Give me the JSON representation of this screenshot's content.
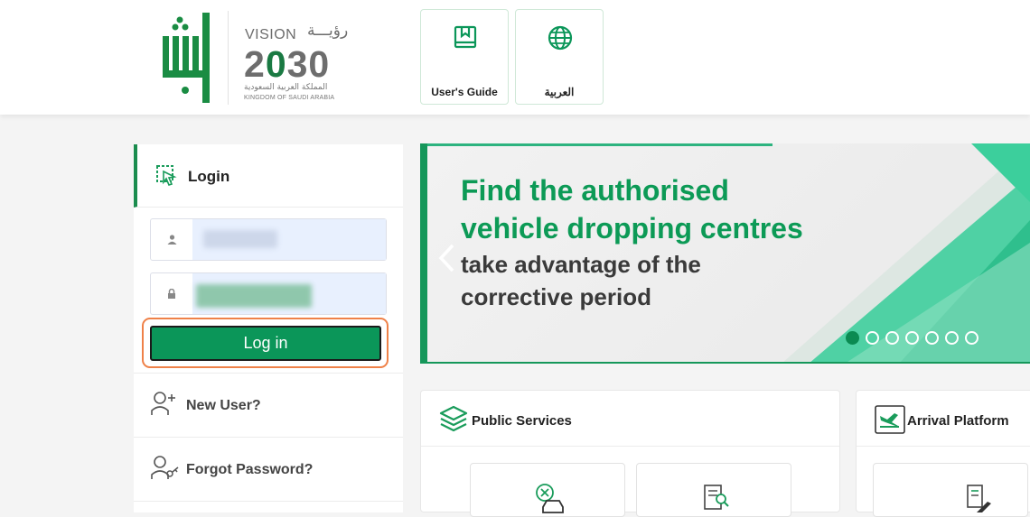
{
  "header": {
    "vision_word": "VISION",
    "vision_arabic": "رؤيـــة",
    "vision_year_prefix": "2",
    "vision_year_mid": "0",
    "vision_year_suffix": "30",
    "kingdom_arabic": "المملكة العربية السعودية",
    "kingdom_english": "KINGDOM OF SAUDI ARABIA",
    "buttons": [
      {
        "label": "User's Guide",
        "icon": "book-icon"
      },
      {
        "label": "العربية",
        "icon": "globe-icon"
      }
    ]
  },
  "login": {
    "title": "Login",
    "username_value": "",
    "password_value": "",
    "login_button": "Log in",
    "new_user": "New User?",
    "forgot_password": "Forgot Password?"
  },
  "banner": {
    "line1": "Find the authorised",
    "line2": "vehicle dropping centres",
    "line3": "take advantage of the",
    "line4": "corrective period",
    "slide_count": 7,
    "active_slide": 1
  },
  "cards": [
    {
      "title": "Public Services",
      "icon": "layers-icon"
    },
    {
      "title": "Arrival Platform",
      "icon": "airplane-arrival-icon"
    }
  ],
  "colors": {
    "brand_green": "#0b9659",
    "accent_orange": "#ef8148"
  }
}
